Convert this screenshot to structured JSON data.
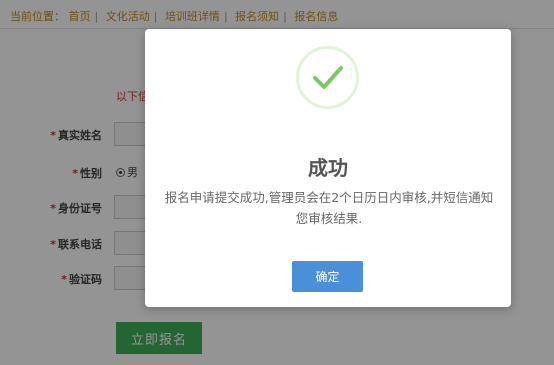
{
  "breadcrumb": {
    "prefix": "当前位置：",
    "items": [
      "首页",
      "文化活动",
      "培训班详情",
      "报名须知",
      "报名信息"
    ]
  },
  "notice": "以下信",
  "form": {
    "fields": [
      {
        "label": "真实姓名",
        "required": true
      },
      {
        "label": "性别",
        "required": true
      },
      {
        "label": "身份证号",
        "required": true
      },
      {
        "label": "联系电话",
        "required": true
      },
      {
        "label": "验证码",
        "required": true
      }
    ],
    "gender_option": "男",
    "submit_label": "立即报名"
  },
  "modal": {
    "title": "成功",
    "message": "报名申请提交成功,管理员会在2个日历日内审核,并短信通知您审核结果.",
    "confirm_label": "确定"
  },
  "colors": {
    "accent": "#4a90d9",
    "submit": "#3fae5a",
    "success": "#7bc964",
    "warning_text": "#c0392b"
  }
}
